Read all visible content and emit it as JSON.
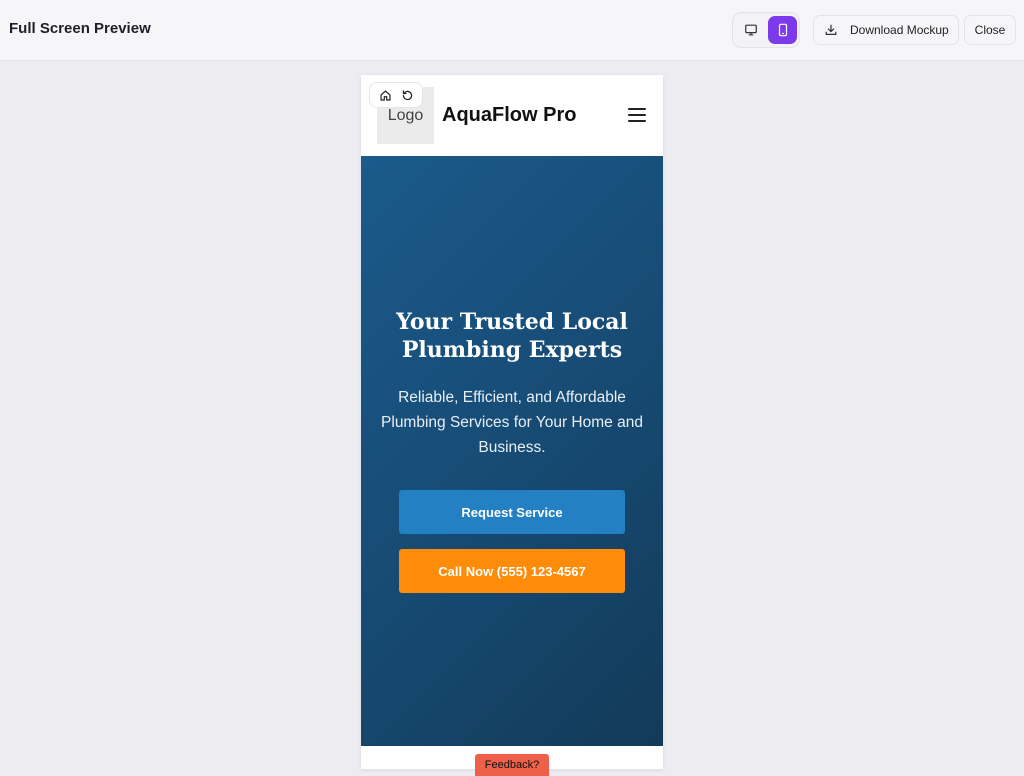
{
  "topbar": {
    "title": "Full Screen Preview",
    "device_toggle": {
      "desktop_icon": "monitor-icon",
      "mobile_icon": "smartphone-icon",
      "selected": "mobile"
    },
    "download_label": "Download Mockup",
    "close_label": "Close"
  },
  "preview_nav": {
    "home_icon": "home-icon",
    "reload_icon": "reload-icon"
  },
  "site": {
    "logo_text": "Logo",
    "brand_name": "AquaFlow Pro",
    "menu_icon": "hamburger-menu-icon",
    "hero": {
      "title": "Your Trusted Local Plumbing Experts",
      "subtitle": "Reliable, Efficient, and Affordable Plumbing Services for Your Home and Business.",
      "primary_button": "Request Service",
      "secondary_button": "Call Now (555) 123-4567"
    }
  },
  "feedback_label": "Feedback?",
  "colors": {
    "accent": "#7c3aed",
    "hero_top": "#1b5a8b",
    "hero_bottom": "#133a58",
    "request_button": "#2280c3",
    "call_button": "#ff8c08",
    "feedback_tab": "#ee6049"
  }
}
